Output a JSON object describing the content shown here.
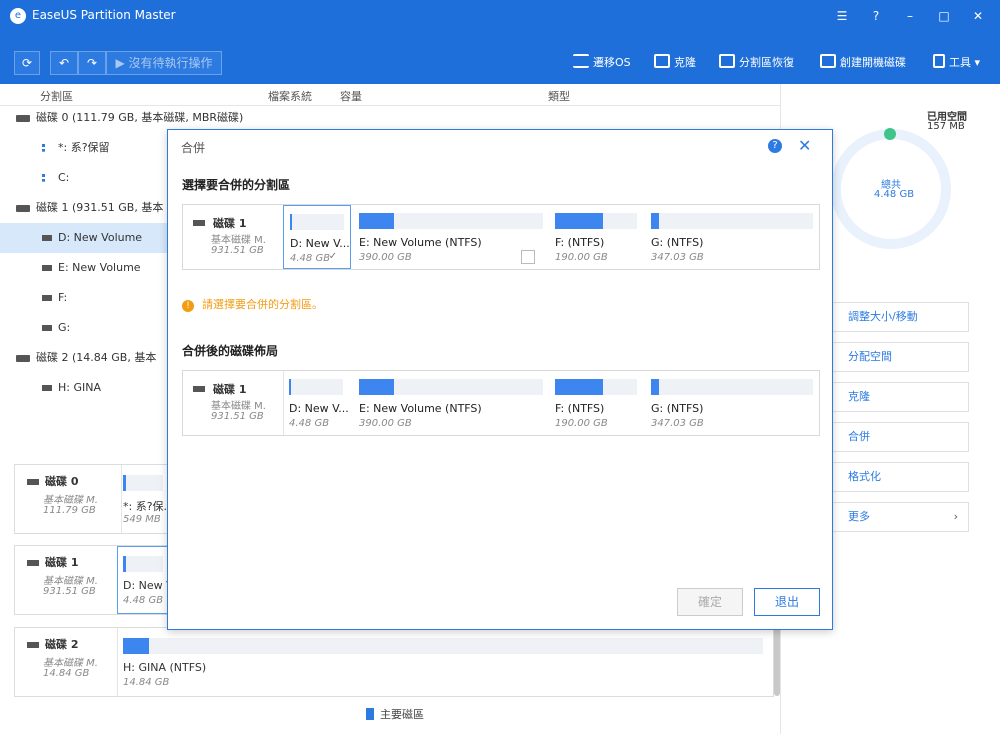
{
  "app": {
    "title": "EaseUS Partition Master"
  },
  "toolbar": {
    "undo_label": "",
    "redo_label": "",
    "pending_label": "沒有待執行操作",
    "tools": [
      {
        "label": "遷移OS",
        "icon": "migrate-os-icon"
      },
      {
        "label": "克隆",
        "icon": "clone-icon"
      },
      {
        "label": "分割區恢復",
        "icon": "partition-recovery-icon"
      },
      {
        "label": "創建開機磁碟",
        "icon": "bootable-disk-icon"
      },
      {
        "label": "工具",
        "icon": "wrench-icon"
      }
    ]
  },
  "table": {
    "headers": [
      "分割區",
      "檔案系統",
      "容量",
      "類型"
    ],
    "rows": [
      {
        "label": "磁碟 0 (111.79 GB, 基本磁碟, MBR磁碟)",
        "kind": "disk"
      },
      {
        "label": "*: 系?保留",
        "kind": "sys"
      },
      {
        "label": "C:",
        "kind": "sys"
      },
      {
        "label": "磁碟 1 (931.51 GB, 基本",
        "kind": "disk"
      },
      {
        "label": "D: New Volume",
        "kind": "part",
        "selected": true
      },
      {
        "label": "E: New Volume",
        "kind": "part"
      },
      {
        "label": "F:",
        "kind": "part"
      },
      {
        "label": "G:",
        "kind": "part"
      },
      {
        "label": "磁碟 2 (14.84 GB, 基本",
        "kind": "disk"
      },
      {
        "label": "H: GINA",
        "kind": "part"
      }
    ]
  },
  "disks": [
    {
      "name": "磁碟 0",
      "type": "基本磁碟 M.",
      "size": "111.79 GB",
      "part_name": "*: 系?保...",
      "part_size": "549 MB"
    },
    {
      "name": "磁碟 1",
      "type": "基本磁碟 M.",
      "size": "931.51 GB",
      "part_name": "D: New V",
      "part_size": "4.48 GB"
    },
    {
      "name": "磁碟 2",
      "type": "基本磁碟 M.",
      "size": "14.84 GB",
      "part_name": "H: GINA (NTFS)",
      "part_size": "14.84 GB"
    }
  ],
  "right": {
    "used_label": "已用空間",
    "used_value": "157 MB",
    "total_label": "總共",
    "total_value": "4.48 GB",
    "actions": [
      "調整大小/移動",
      "分配空間",
      "克隆",
      "合併",
      "格式化",
      "更多"
    ]
  },
  "modal": {
    "title": "合併",
    "select_heading": "選擇要合併的分割區",
    "warning": "請選擇要合併的分割區。",
    "result_heading": "合併後的磁碟佈局",
    "disk_label": "磁碟 1",
    "disk_type": "基本磁碟 M.",
    "disk_size": "931.51 GB",
    "partitions": [
      {
        "name": "D: New V...",
        "size": "4.48 GB",
        "fill": 0.02
      },
      {
        "name": "E: New Volume (NTFS)",
        "size": "390.00 GB",
        "fill": 0.19
      },
      {
        "name": "F:  (NTFS)",
        "size": "190.00 GB",
        "fill": 0.58
      },
      {
        "name": "G:  (NTFS)",
        "size": "347.03 GB",
        "fill": 0.05
      }
    ],
    "ok_label": "確定",
    "exit_label": "退出"
  },
  "legend": {
    "primary": "主要磁區"
  },
  "colors": {
    "brand": "#1e6fd9",
    "accent": "#3d86f0",
    "warning": "#f39c12",
    "used": "#3fc48a"
  }
}
